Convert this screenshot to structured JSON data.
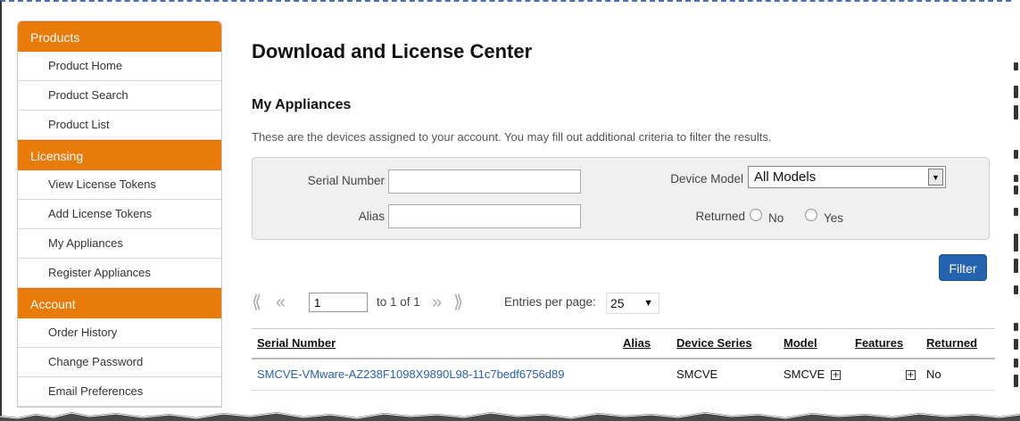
{
  "sidebar": {
    "sections": [
      {
        "header": "Products",
        "items": [
          "Product Home",
          "Product Search",
          "Product List"
        ]
      },
      {
        "header": "Licensing",
        "items": [
          "View License Tokens",
          "Add License Tokens",
          "My Appliances",
          "Register Appliances"
        ]
      },
      {
        "header": "Account",
        "items": [
          "Order History",
          "Change Password",
          "Email Preferences"
        ]
      }
    ]
  },
  "main": {
    "title": "Download and License Center",
    "section_title": "My Appliances",
    "description": "These are the devices assigned to your account. You may fill out additional criteria to filter the results."
  },
  "filter": {
    "serial_label": "Serial Number",
    "serial_value": "",
    "alias_label": "Alias",
    "alias_value": "",
    "model_label": "Device Model",
    "model_value": "All Models",
    "returned_label": "Returned",
    "returned_no": "No",
    "returned_yes": "Yes",
    "button": "Filter"
  },
  "pager": {
    "page_value": "1",
    "range_text": "to 1 of 1",
    "entries_label": "Entries per page:",
    "entries_value": "25"
  },
  "table": {
    "headers": [
      "Serial Number",
      "Alias",
      "Device Series",
      "Model",
      "Features",
      "Returned"
    ],
    "rows": [
      {
        "serial": "SMCVE-VMware-AZ238F1098X9890L98-11c7bedf6756d89",
        "alias": "",
        "series": "SMCVE",
        "model": "SMCVE",
        "features": "",
        "returned": "No"
      }
    ]
  },
  "icons": {
    "first_page": "first-page-icon",
    "prev_page": "prev-page-icon",
    "next_page": "next-page-icon",
    "last_page": "last-page-icon",
    "expand": "plus-box-icon"
  },
  "colors": {
    "sidebar_header": "#e87b0a",
    "filter_button": "#2463b0",
    "link": "#2a62b0"
  }
}
